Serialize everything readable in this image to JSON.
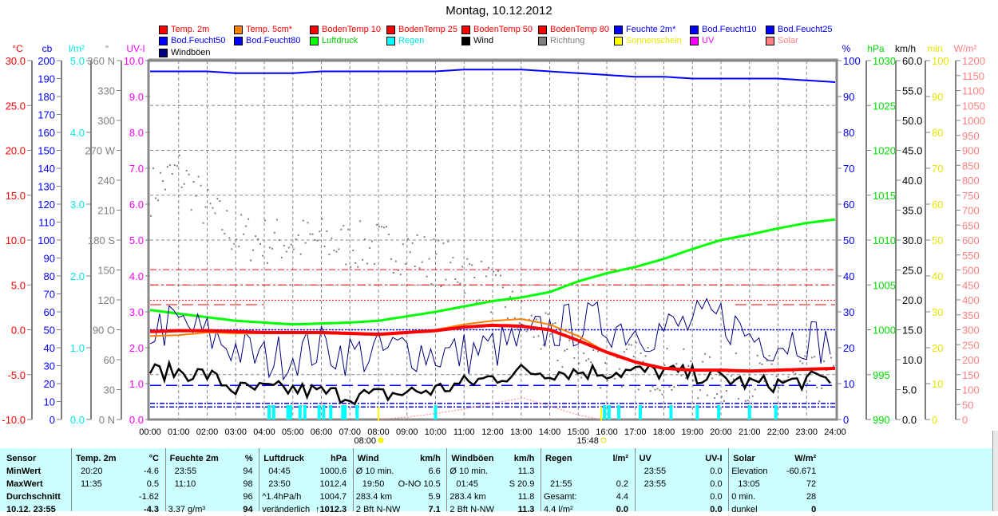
{
  "chart_data": {
    "type": "line",
    "title": "Montag, 10.12.2012",
    "x_range_hours": [
      0,
      24
    ],
    "x_ticks": [
      "00:00",
      "01:00",
      "02:00",
      "03:00",
      "04:00",
      "05:00",
      "06:00",
      "07:00",
      "08:00",
      "09:00",
      "10:00",
      "11:00",
      "12:00",
      "13:00",
      "14:00",
      "15:00",
      "16:00",
      "17:00",
      "18:00",
      "19:00",
      "20:00",
      "21:00",
      "22:00",
      "23:00",
      "24:00"
    ],
    "sunrise": {
      "label": "08:00",
      "hour": 8.0
    },
    "sunset": {
      "label": "15:48",
      "hour": 15.8
    },
    "legend": [
      {
        "label": "Temp. 2m",
        "color": "#ff0000",
        "text_color": "#ff0000"
      },
      {
        "label": "Temp. 5cm*",
        "color": "#ff8000",
        "text_color": "#ff0000"
      },
      {
        "label": "BodenTemp 10",
        "color": "#ff0000",
        "text_color": "#ff0000"
      },
      {
        "label": "BodenTemp 25",
        "color": "#ff0000",
        "text_color": "#ff0000"
      },
      {
        "label": "BodenTemp 50",
        "color": "#ff0000",
        "text_color": "#ff0000"
      },
      {
        "label": "BodenTemp 80",
        "color": "#ff0000",
        "text_color": "#ff0000"
      },
      {
        "label": "Feuchte 2m*",
        "color": "#0000ff",
        "text_color": "#0000ff"
      },
      {
        "label": "Bod.Feucht10",
        "color": "#0000ff",
        "text_color": "#0000ff"
      },
      {
        "label": "Bod.Feucht25",
        "color": "#0000ff",
        "text_color": "#0000ff"
      },
      {
        "label": "Bod.Feucht50",
        "color": "#0000ff",
        "text_color": "#0000ff"
      },
      {
        "label": "Bod.Feucht80",
        "color": "#0000ff",
        "text_color": "#0000ff"
      },
      {
        "label": "Luftdruck",
        "color": "#00ff00",
        "text_color": "#00cc00"
      },
      {
        "label": "Regen",
        "color": "#00ffff",
        "text_color": "#00e0e0"
      },
      {
        "label": "Wind",
        "color": "#000000",
        "text_color": "#000000"
      },
      {
        "label": "Richtung",
        "color": "#808080",
        "text_color": "#808080"
      },
      {
        "label": "Sonnenschein",
        "color": "#ffff00",
        "text_color": "#e6e600"
      },
      {
        "label": "UV",
        "color": "#ff00ff",
        "text_color": "#ff00ff"
      },
      {
        "label": "Solar",
        "color": "#ff8080",
        "text_color": "#ff8080"
      },
      {
        "label": "Windböen",
        "color": "#000080",
        "text_color": "#000000"
      }
    ],
    "axes": {
      "temp": {
        "unit": "°C",
        "color": "#ff0000",
        "min": -10,
        "max": 30,
        "ticks": [
          "30.0",
          "25.0",
          "20.0",
          "15.0",
          "10.0",
          "5.0",
          "0.0",
          "-5.0",
          "-10.0"
        ]
      },
      "cb": {
        "unit": "cb",
        "color": "#0000ff",
        "min": 0,
        "max": 200,
        "ticks": [
          "200",
          "190",
          "180",
          "170",
          "160",
          "150",
          "140",
          "130",
          "120",
          "110",
          "100",
          "90",
          "80",
          "70",
          "60",
          "50",
          "40",
          "30",
          "20",
          "10",
          "0"
        ]
      },
      "rain": {
        "unit": "l/m²",
        "color": "#00e6e6",
        "min": 0,
        "max": 5,
        "ticks": [
          "5.0",
          "4.0",
          "3.0",
          "2.0",
          "1.0",
          "0.0"
        ]
      },
      "dir": {
        "unit": "°",
        "color": "#808080",
        "min": 0,
        "max": 360,
        "ticks": [
          "360 N",
          "330",
          "300",
          "270 W",
          "240",
          "210",
          "180 S",
          "150",
          "120",
          "90 O",
          "60",
          "30",
          "0 N"
        ]
      },
      "uv": {
        "unit": "UV-I",
        "color": "#ff00ff",
        "min": 0,
        "max": 10,
        "ticks": [
          "10.0",
          "9.0",
          "8.0",
          "7.0",
          "6.0",
          "5.0",
          "4.0",
          "3.0",
          "2.0",
          "1.0",
          "0.0"
        ]
      },
      "hum": {
        "unit": "%",
        "color": "#0000ff",
        "min": 0,
        "max": 100,
        "ticks": [
          "100",
          "90",
          "80",
          "70",
          "60",
          "50",
          "40",
          "30",
          "20",
          "10",
          "0"
        ]
      },
      "press": {
        "unit": "hPa",
        "color": "#00dd00",
        "min": 990,
        "max": 1030,
        "ticks": [
          "1030",
          "1025",
          "1020",
          "1015",
          "1010",
          "1005",
          "1000",
          "995",
          "990"
        ]
      },
      "wind": {
        "unit": "km/h",
        "color": "#000000",
        "min": 0,
        "max": 60,
        "ticks": [
          "60.0",
          "55.0",
          "50.0",
          "45.0",
          "40.0",
          "35.0",
          "30.0",
          "25.0",
          "20.0",
          "15.0",
          "10.0",
          "5.0",
          "0.0"
        ]
      },
      "sun": {
        "unit": "min",
        "color": "#e6e600",
        "min": 0,
        "max": 100,
        "ticks": [
          "100",
          "90",
          "80",
          "70",
          "60",
          "50",
          "40",
          "30",
          "20",
          "10",
          "0"
        ]
      },
      "solar": {
        "unit": "W/m²",
        "color": "#ff8080",
        "min": 0,
        "max": 1200,
        "ticks": [
          "1200",
          "1150",
          "1100",
          "1050",
          "1000",
          "950",
          "900",
          "850",
          "800",
          "750",
          "700",
          "650",
          "600",
          "550",
          "500",
          "450",
          "400",
          "350",
          "300",
          "250",
          "200",
          "150",
          "100",
          "50",
          "0"
        ]
      }
    },
    "series_hourly": {
      "temp_2m": [
        -0.2,
        -0.1,
        -0.1,
        -0.2,
        -0.3,
        -0.3,
        -0.3,
        -0.4,
        -0.5,
        -0.3,
        -0.1,
        0.3,
        0.5,
        0.4,
        0.0,
        -1.2,
        -2.5,
        -3.6,
        -4.3,
        -4.5,
        -4.5,
        -4.6,
        -4.5,
        -4.4,
        -4.3
      ],
      "temp_5cm": [
        -0.7,
        -0.6,
        -0.3,
        -0.4,
        -0.4,
        -0.4,
        -0.4,
        -0.5,
        -0.6,
        -0.4,
        0.0,
        0.6,
        1.0,
        1.2,
        0.6,
        -0.7,
        -2.5,
        -3.6,
        -4.3,
        -4.5,
        -4.5,
        -4.6,
        -4.5,
        -4.4,
        -4.3
      ],
      "humidity_2m": [
        97,
        97,
        97,
        96.5,
        96.5,
        96.5,
        97,
        97,
        97,
        97,
        97,
        97.5,
        97.5,
        97.5,
        97,
        96.5,
        96,
        95.5,
        95.5,
        95,
        95,
        95,
        95,
        94.5,
        94
      ],
      "pressure": [
        1002.2,
        1001.8,
        1001.4,
        1001.0,
        1000.8,
        1000.6,
        1000.7,
        1000.8,
        1001.0,
        1001.5,
        1002.0,
        1002.6,
        1003.2,
        1003.6,
        1004.2,
        1005.4,
        1006.3,
        1007.0,
        1007.9,
        1009.0,
        1010.0,
        1010.6,
        1011.3,
        1011.9,
        1012.3
      ],
      "wind": [
        8,
        8,
        7.5,
        5,
        5,
        5,
        4.5,
        4,
        4,
        4.5,
        5,
        6,
        7,
        8,
        8,
        8,
        8,
        8,
        8,
        7.5,
        7,
        6,
        6,
        6.5,
        7
      ],
      "gusts": [
        15,
        16,
        14,
        12,
        10,
        11,
        12,
        11,
        11,
        12,
        11,
        11,
        12,
        13,
        15,
        16,
        16,
        15,
        15,
        16,
        17,
        14,
        13,
        14,
        12
      ],
      "direction": [
        230,
        250,
        210,
        185,
        180,
        180,
        180,
        175,
        175,
        170,
        160,
        150,
        130,
        100,
        80,
        60,
        55,
        55,
        50,
        45,
        40,
        45,
        40,
        40,
        40
      ]
    },
    "solar_points": [
      [
        8,
        0
      ],
      [
        9,
        8
      ],
      [
        10,
        20
      ],
      [
        11,
        35
      ],
      [
        12,
        55
      ],
      [
        13.08,
        72
      ],
      [
        14,
        45
      ],
      [
        15,
        15
      ],
      [
        15.8,
        0
      ]
    ],
    "rain_events": {
      "value": 0.2,
      "hours": [
        4.17,
        4.33,
        4.83,
        4.92,
        5.25,
        5.42,
        5.92,
        6.08,
        6.33,
        6.75,
        6.83,
        7.25,
        10.0,
        15.92,
        16.08,
        16.42,
        17.17,
        18.25,
        19.17,
        19.92,
        21.0,
        21.92
      ]
    },
    "soil_temp": [
      {
        "name": "BodenTemp 10",
        "value": 6.7,
        "dash": "8 3 2 3"
      },
      {
        "name": "BodenTemp 25",
        "value": 5.0,
        "dash": "10 4 2 4"
      },
      {
        "name": "BodenTemp 50",
        "value": 3.3,
        "dash": "2 2"
      },
      {
        "name": "BodenTemp 80",
        "value": 2.8,
        "dash": "14 6",
        "ranges": [
          [
            0,
            4
          ],
          [
            20.5,
            24
          ]
        ]
      }
    ],
    "soil_moisture": [
      {
        "name": "Bod.Feucht10",
        "value": 50,
        "dash": "2 2"
      },
      {
        "name": "Bod.Feucht25",
        "value": 19,
        "dash": "14 6"
      },
      {
        "name": "Bod.Feucht50",
        "value": 9,
        "dash": "6 2 2 2"
      },
      {
        "name": "Bod.Feucht80",
        "value": 7,
        "dash": "6 2 2 2"
      }
    ]
  },
  "table": {
    "columns": [
      {
        "title": "Temp. 2m",
        "unit": "°C"
      },
      {
        "title": "Feuchte 2m",
        "unit": "%"
      },
      {
        "title": "Luftdruck",
        "unit": "hPa"
      },
      {
        "title": "Wind",
        "unit": "km/h"
      },
      {
        "title": "Windböen",
        "unit": "km/h"
      },
      {
        "title": "Regen",
        "unit": "l/m²"
      },
      {
        "title": "UV",
        "unit": "UV-I"
      },
      {
        "title": "Solar",
        "unit": "W/m²"
      }
    ],
    "sensor_header": "Sensor",
    "rows": [
      {
        "label": "MinWert",
        "cells": [
          [
            "20:20",
            "-4.6"
          ],
          [
            "23:55",
            "94"
          ],
          [
            "04:45",
            "1000.6"
          ],
          [
            "Ø 10 min.",
            "6.6"
          ],
          [
            "Ø 10 min.",
            "11.3"
          ],
          [
            "",
            ""
          ],
          [
            "23:55",
            "0.0"
          ],
          [
            "Elevation",
            "-60.671"
          ]
        ]
      },
      {
        "label": "MaxWert",
        "cells": [
          [
            "11:35",
            "0.5"
          ],
          [
            "11:10",
            "98"
          ],
          [
            "23:50",
            "1012.4"
          ],
          [
            "19:50",
            "O-NO 10.5"
          ],
          [
            "01:45",
            "S 20.9"
          ],
          [
            "21:55",
            "0.2"
          ],
          [
            "23:55",
            "0.0"
          ],
          [
            "13:05",
            "72"
          ]
        ]
      },
      {
        "label": "Durchschnitt",
        "cells": [
          [
            "",
            "-1.62"
          ],
          [
            "",
            "96"
          ],
          [
            "^1.4hPa/h",
            "1004.7"
          ],
          [
            "283.4 km",
            "5.9"
          ],
          [
            "283.4 km",
            "11.8"
          ],
          [
            "Gesamt:",
            "4.4"
          ],
          [
            "",
            "0.0"
          ],
          [
            "0 min.",
            "28"
          ]
        ]
      },
      {
        "label": "10.12. 23:55",
        "cells": [
          [
            "",
            "-4.3"
          ],
          [
            "3.37 g/m³",
            "94"
          ],
          [
            "veränderlich",
            "↑1012.3"
          ],
          [
            "2 Bft N-NW",
            "7.1"
          ],
          [
            "2 Bft N-NW",
            "11.3"
          ],
          [
            "4.4 l/m²",
            "0.0"
          ],
          [
            "",
            "0.0"
          ],
          [
            "dunkel",
            "0"
          ]
        ]
      }
    ]
  }
}
